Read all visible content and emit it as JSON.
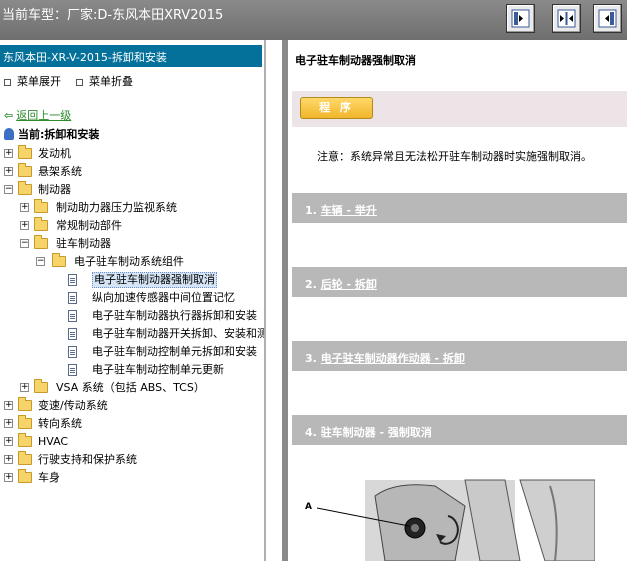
{
  "window": {
    "title": "当前车型：厂家:D-东风本田XRV2015"
  },
  "toolbar": {
    "buttons": [
      "layout-left-icon",
      "layout-split-icon",
      "layout-right-icon"
    ]
  },
  "left": {
    "header": "东风本田-XR-V-2015-拆卸和安装",
    "expand_all": "菜单展开",
    "collapse_all": "菜单折叠",
    "back": "返回上一级",
    "current": "当前:拆卸和安装",
    "tree": [
      {
        "label": "发动机",
        "expanded": false,
        "level": 0
      },
      {
        "label": "悬架系统",
        "expanded": false,
        "level": 0
      },
      {
        "label": "制动器",
        "expanded": true,
        "level": 0
      },
      {
        "label": "制动助力器压力监视系统",
        "expanded": false,
        "level": 1
      },
      {
        "label": "常规制动部件",
        "expanded": false,
        "level": 1
      },
      {
        "label": "驻车制动器",
        "expanded": true,
        "level": 1
      },
      {
        "label": "电子驻车制动系统组件",
        "expanded": true,
        "level": 2
      },
      {
        "label": "电子驻车制动器强制取消",
        "leaf": true,
        "selected": true,
        "level": 3
      },
      {
        "label": "纵向加速传感器中间位置记忆",
        "leaf": true,
        "level": 3
      },
      {
        "label": "电子驻车制动器执行器拆卸和安装",
        "leaf": true,
        "level": 3
      },
      {
        "label": "电子驻车制动器开关拆卸、安装和测",
        "leaf": true,
        "level": 3
      },
      {
        "label": "电子驻车制动控制单元拆卸和安装",
        "leaf": true,
        "level": 3
      },
      {
        "label": "电子驻车制动控制单元更新",
        "leaf": true,
        "level": 3
      },
      {
        "label": "VSA 系统（包括 ABS、TCS）",
        "expanded": false,
        "level": 1
      },
      {
        "label": "变速/传动系统",
        "expanded": false,
        "level": 0
      },
      {
        "label": "转向系统",
        "expanded": false,
        "level": 0
      },
      {
        "label": "HVAC",
        "expanded": false,
        "level": 0
      },
      {
        "label": "行驶支持和保护系统",
        "expanded": false,
        "level": 0
      },
      {
        "label": "车身",
        "expanded": false,
        "level": 0
      }
    ]
  },
  "right": {
    "title": "电子驻车制动器强制取消",
    "procedure_button": "程 序",
    "notice": "注意：系统异常且无法松开驻车制动器时实施强制取消。",
    "steps": [
      {
        "num": "1.",
        "text": "车辆 - 举升",
        "link": true
      },
      {
        "num": "2.",
        "text": "后轮 - 拆卸",
        "link": true
      },
      {
        "num": "3.",
        "text": "电子驻车制动器作动器 - 拆卸",
        "link": true
      },
      {
        "num": "4.",
        "text": "驻车制动器 - 强制取消",
        "link": false
      }
    ],
    "figure_label": "A"
  },
  "colors": {
    "header_blue": "#04719b",
    "step_gray": "#b8b8b8",
    "button_gold": "#f1b52b",
    "link_green": "#2b8a2b"
  }
}
